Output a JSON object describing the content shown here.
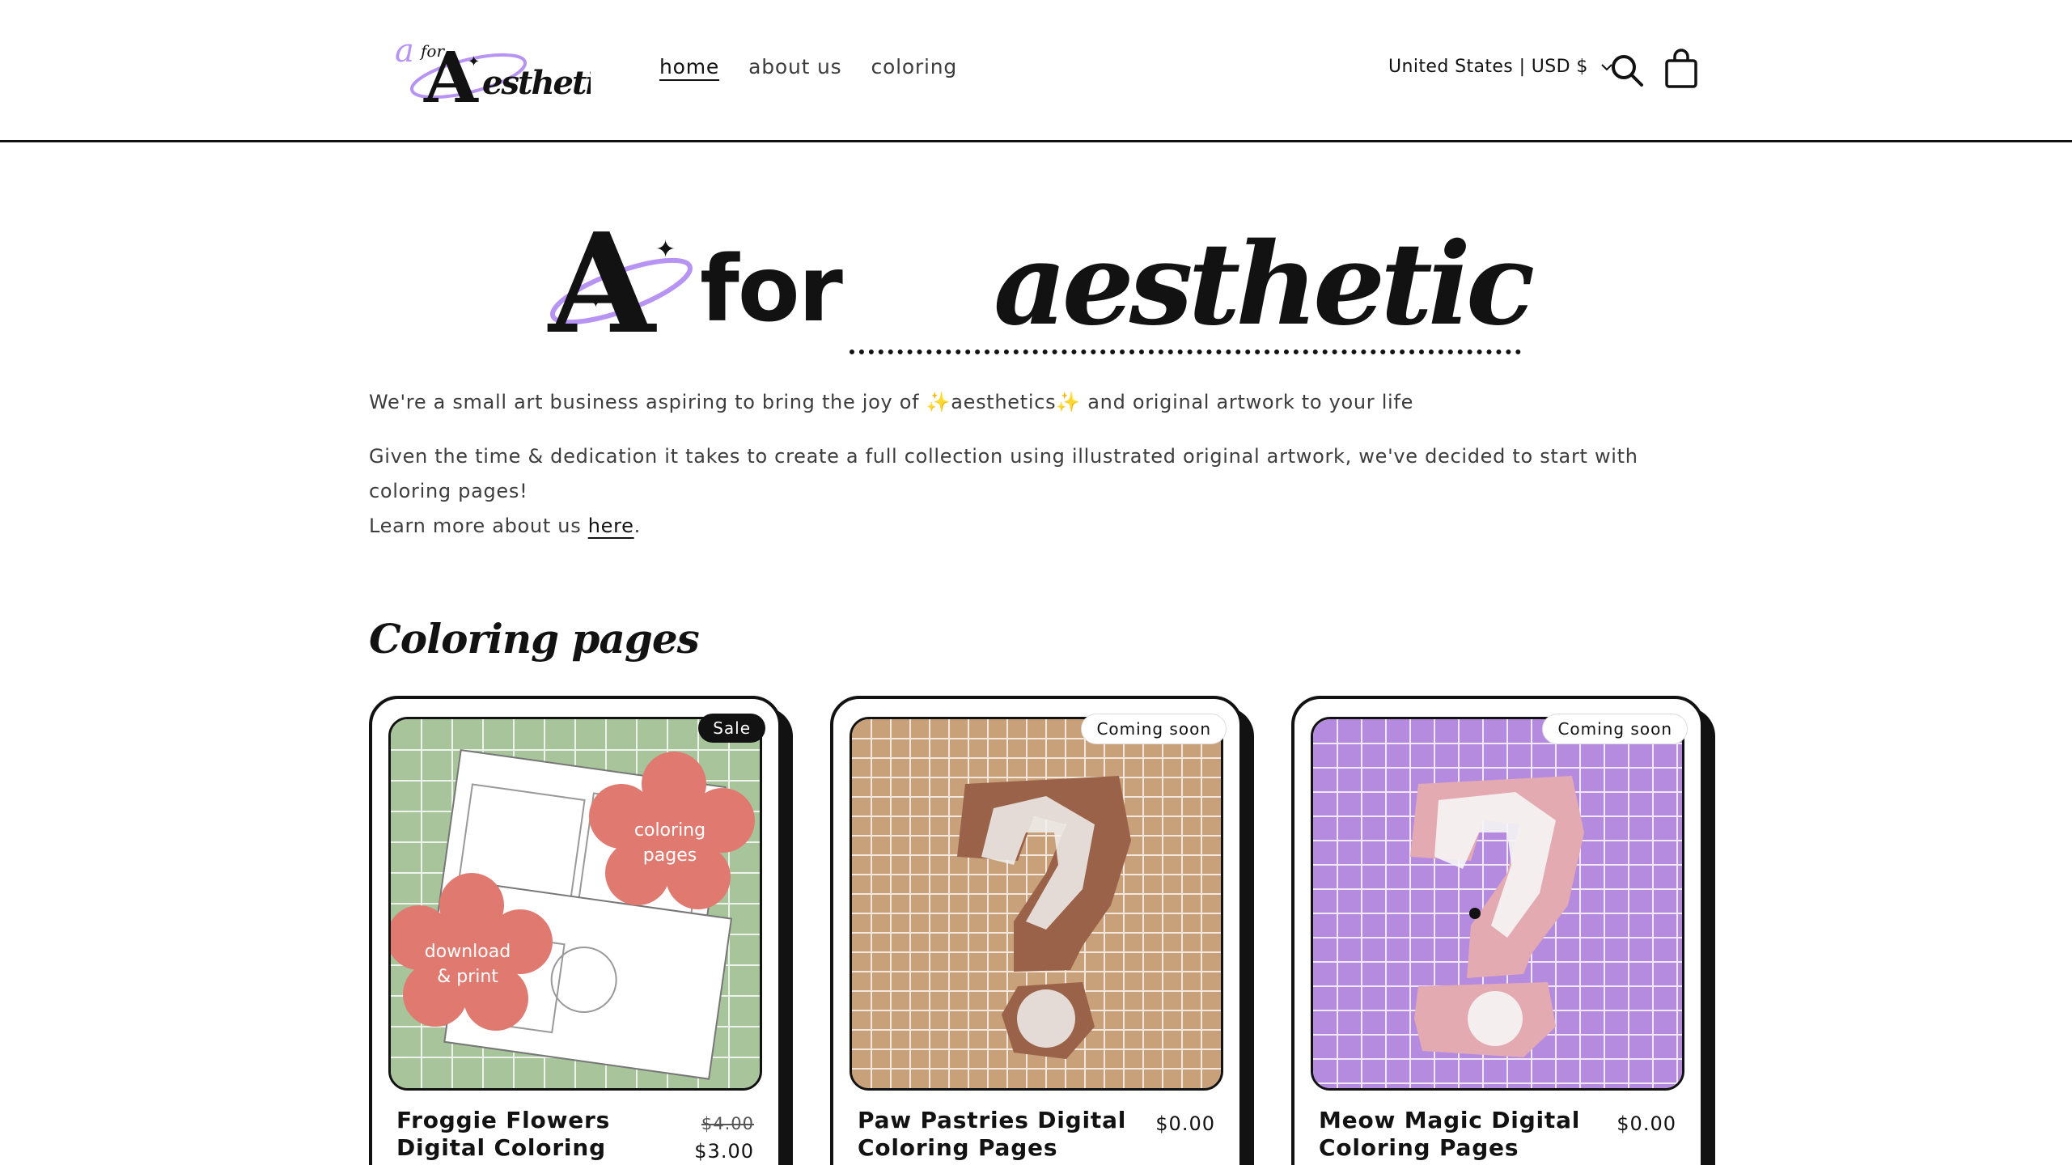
{
  "header": {
    "logo_alt": "a for Aesthetic",
    "nav": [
      {
        "label": "home",
        "active": true
      },
      {
        "label": "about us",
        "active": false
      },
      {
        "label": "coloring",
        "active": false
      }
    ],
    "locale": "United States | USD $",
    "icons": {
      "search": "search-icon",
      "cart": "cart-icon",
      "chevron": "chevron-down-icon"
    }
  },
  "hero": {
    "letter": "A",
    "for": "for",
    "aesthetic": "aesthetic",
    "accent_color": "#b794f4"
  },
  "intro": {
    "line1_a": "We're a small art business aspiring to bring the joy of ",
    "sparkle": "✨",
    "line1_b": "aesthetics",
    "line1_c": " and original artwork to your life",
    "line2": "Given the time & dedication it takes to create a full collection using illustrated original artwork, we've decided to start with coloring pages!",
    "line3_a": "Learn more about us ",
    "line3_link": "here",
    "line3_b": "."
  },
  "section": {
    "title": "Coloring pages"
  },
  "products": [
    {
      "title": "Froggie Flowers Digital Coloring Pages",
      "badge": "Sale",
      "old_price": "$4.00",
      "price": "$3.00",
      "bg_color": "#a8c49a",
      "blob1": "coloring pages",
      "blob2": "download & print",
      "blob_color": "#e07a70"
    },
    {
      "title": "Paw Pastries Digital Coloring Pages",
      "badge": "Coming soon",
      "price": "$0.00",
      "bg_color": "#c8a07a",
      "shape_color": "#9a6248"
    },
    {
      "title": "Meow Magic Digital Coloring Pages",
      "badge": "Coming soon",
      "price": "$0.00",
      "bg_color": "#b58be0",
      "shape_color": "#e4aab2"
    }
  ]
}
